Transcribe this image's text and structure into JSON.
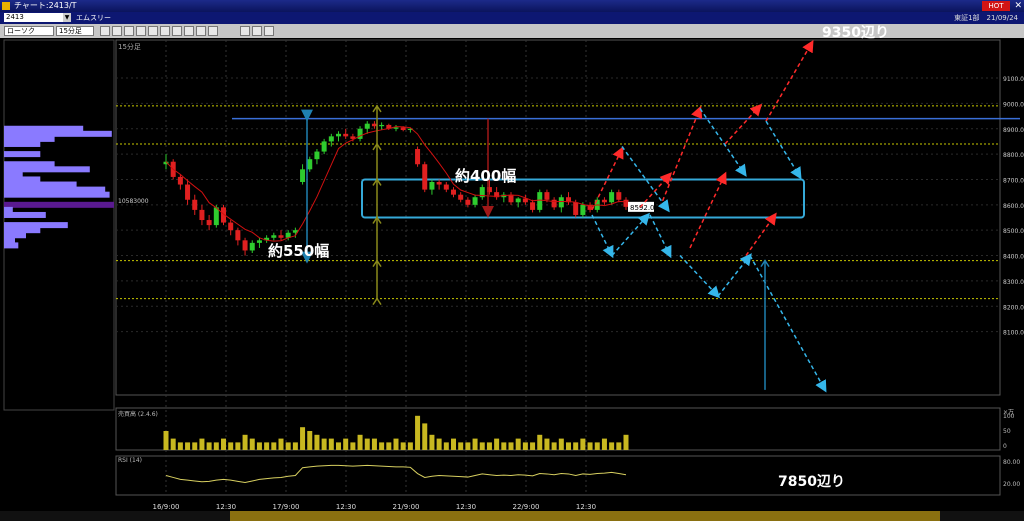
{
  "window": {
    "title": "チャート:2413/T",
    "hot_label": "HOT",
    "close_glyph": "✕",
    "symbol_code": "2413",
    "company": "エムスリー",
    "exchange_date": "東証1部　21/09/24"
  },
  "toolbar": {
    "chart_type": "ローソク",
    "timeframe": "15分足",
    "buttons": [
      "zoom-in-icon",
      "zoom-out-icon",
      "grid-icon",
      "bar-chart-icon",
      "line-chart-icon",
      "candle-icon",
      "draw-line-icon",
      "fib-icon",
      "marker-icon",
      "settings-icon",
      "circle-icon",
      "wave-icon",
      "text-icon"
    ]
  },
  "colors": {
    "up": "#2ecc2e",
    "down": "#e02020",
    "ma": "#d01010",
    "yellow_line": "#c8c800",
    "blue_line": "#3a6fd8",
    "cyan_box": "#35a9d8",
    "volume": "#c8b820",
    "arrow_red": "#ff2a2a",
    "arrow_cyan": "#35b6ea",
    "profile": "#8a7aff",
    "profile_highlight": "#5a1a90",
    "olive": "#8a8a1a",
    "steel": "#1f80b0",
    "maroon": "#a01818",
    "rsi": "#d8d060"
  },
  "chart_data": {
    "type": "candlestick",
    "timeframe_label": "15分足",
    "ylim": [
      7850,
      9250
    ],
    "y_ticks": [
      8100,
      8200,
      8300,
      8400,
      8500,
      8600,
      8700,
      8800,
      8900,
      9000,
      9100
    ],
    "x_labels": [
      "16/9:00",
      "12:30",
      "17/9:00",
      "12:30",
      "21/9:00",
      "12:30",
      "22/9:00",
      "12:30"
    ],
    "x_label_positions": [
      0,
      10,
      20,
      30,
      40,
      50,
      60,
      70
    ],
    "last_price": "8592.0",
    "mouse_price": "10583000",
    "levels": [
      8990,
      8840,
      8380,
      8230
    ],
    "resistance_line": 8940,
    "candles": [
      [
        8760,
        8800,
        8740,
        8770
      ],
      [
        8770,
        8780,
        8700,
        8710
      ],
      [
        8710,
        8720,
        8660,
        8680
      ],
      [
        8680,
        8700,
        8600,
        8620
      ],
      [
        8620,
        8640,
        8560,
        8580
      ],
      [
        8580,
        8600,
        8520,
        8540
      ],
      [
        8540,
        8560,
        8500,
        8520
      ],
      [
        8520,
        8600,
        8510,
        8590
      ],
      [
        8590,
        8600,
        8520,
        8530
      ],
      [
        8530,
        8540,
        8480,
        8500
      ],
      [
        8500,
        8510,
        8440,
        8460
      ],
      [
        8460,
        8470,
        8400,
        8420
      ],
      [
        8420,
        8460,
        8410,
        8450
      ],
      [
        8450,
        8470,
        8430,
        8460
      ],
      [
        8460,
        8480,
        8450,
        8470
      ],
      [
        8470,
        8490,
        8460,
        8480
      ],
      [
        8480,
        8500,
        8460,
        8470
      ],
      [
        8470,
        8500,
        8460,
        8490
      ],
      [
        8490,
        8510,
        8470,
        8500
      ],
      [
        8690,
        8760,
        8680,
        8740
      ],
      [
        8740,
        8790,
        8730,
        8780
      ],
      [
        8780,
        8820,
        8760,
        8810
      ],
      [
        8810,
        8860,
        8800,
        8850
      ],
      [
        8850,
        8880,
        8830,
        8870
      ],
      [
        8870,
        8890,
        8850,
        8880
      ],
      [
        8880,
        8900,
        8860,
        8870
      ],
      [
        8870,
        8880,
        8850,
        8860
      ],
      [
        8860,
        8910,
        8850,
        8900
      ],
      [
        8900,
        8930,
        8880,
        8920
      ],
      [
        8920,
        8930,
        8900,
        8910
      ],
      [
        8910,
        8925,
        8895,
        8915
      ],
      [
        8915,
        8920,
        8895,
        8900
      ],
      [
        8900,
        8915,
        8890,
        8905
      ],
      [
        8905,
        8910,
        8890,
        8895
      ],
      [
        8895,
        8905,
        8885,
        8900
      ],
      [
        8820,
        8830,
        8750,
        8760
      ],
      [
        8760,
        8770,
        8650,
        8660
      ],
      [
        8660,
        8700,
        8640,
        8690
      ],
      [
        8690,
        8700,
        8660,
        8680
      ],
      [
        8680,
        8690,
        8650,
        8660
      ],
      [
        8660,
        8670,
        8630,
        8640
      ],
      [
        8640,
        8650,
        8610,
        8620
      ],
      [
        8620,
        8630,
        8590,
        8600
      ],
      [
        8600,
        8640,
        8590,
        8630
      ],
      [
        8630,
        8680,
        8620,
        8670
      ],
      [
        8670,
        8700,
        8640,
        8650
      ],
      [
        8650,
        8670,
        8620,
        8630
      ],
      [
        8630,
        8650,
        8610,
        8640
      ],
      [
        8640,
        8650,
        8600,
        8610
      ],
      [
        8610,
        8630,
        8590,
        8625
      ],
      [
        8625,
        8640,
        8600,
        8610
      ],
      [
        8610,
        8620,
        8570,
        8580
      ],
      [
        8580,
        8660,
        8570,
        8650
      ],
      [
        8650,
        8660,
        8610,
        8620
      ],
      [
        8620,
        8630,
        8580,
        8590
      ],
      [
        8590,
        8640,
        8570,
        8630
      ],
      [
        8630,
        8650,
        8600,
        8610
      ],
      [
        8610,
        8620,
        8550,
        8560
      ],
      [
        8560,
        8610,
        8550,
        8600
      ],
      [
        8600,
        8610,
        8570,
        8580
      ],
      [
        8580,
        8630,
        8570,
        8620
      ],
      [
        8620,
        8630,
        8600,
        8610
      ],
      [
        8610,
        8660,
        8600,
        8650
      ],
      [
        8650,
        8660,
        8610,
        8620
      ],
      [
        8620,
        8630,
        8580,
        8592
      ]
    ],
    "volume_values": [
      5,
      3,
      2,
      2,
      2,
      3,
      2,
      2,
      3,
      2,
      2,
      4,
      3,
      2,
      2,
      2,
      3,
      2,
      2,
      6,
      5,
      4,
      3,
      3,
      2,
      3,
      2,
      4,
      3,
      3,
      2,
      2,
      3,
      2,
      2,
      9,
      7,
      4,
      3,
      2,
      3,
      2,
      2,
      3,
      2,
      2,
      3,
      2,
      2,
      3,
      2,
      2,
      4,
      3,
      2,
      3,
      2,
      2,
      3,
      2,
      2,
      3,
      2,
      2,
      4
    ],
    "rsi_values": [
      50,
      45,
      40,
      38,
      36,
      34,
      35,
      38,
      40,
      38,
      35,
      32,
      36,
      40,
      42,
      44,
      45,
      48,
      50,
      70,
      72,
      74,
      75,
      76,
      76,
      75,
      74,
      75,
      76,
      75,
      74,
      73,
      72,
      72,
      71,
      55,
      45,
      48,
      50,
      49,
      48,
      47,
      46,
      50,
      54,
      52,
      50,
      51,
      50,
      52,
      51,
      49,
      55,
      54,
      52,
      55,
      54,
      50,
      54,
      53,
      55,
      56,
      58,
      55,
      52
    ],
    "profile_bars": [
      {
        "price": 8900,
        "width": 0.72
      },
      {
        "price": 8880,
        "width": 0.98
      },
      {
        "price": 8860,
        "width": 0.46
      },
      {
        "price": 8840,
        "width": 0.33
      },
      {
        "price": 8800,
        "width": 0.33
      },
      {
        "price": 8760,
        "width": 0.46
      },
      {
        "price": 8740,
        "width": 0.78
      },
      {
        "price": 8720,
        "width": 0.17
      },
      {
        "price": 8700,
        "width": 0.33
      },
      {
        "price": 8680,
        "width": 0.66
      },
      {
        "price": 8660,
        "width": 0.92
      },
      {
        "price": 8640,
        "width": 0.96
      },
      {
        "price": 8600,
        "width": 1.0,
        "highlight": true
      },
      {
        "price": 8580,
        "width": 0.08
      },
      {
        "price": 8560,
        "width": 0.38
      },
      {
        "price": 8520,
        "width": 0.58
      },
      {
        "price": 8500,
        "width": 0.33
      },
      {
        "price": 8480,
        "width": 0.2
      },
      {
        "price": 8460,
        "width": 0.1
      },
      {
        "price": 8440,
        "width": 0.13
      }
    ],
    "annotations": {
      "w550": "約550幅",
      "w400": "約400幅",
      "target_high": "9350辺り",
      "target_low": "7850辺り"
    },
    "volume_panel": {
      "label": "売買高 (2.4.6)",
      "unit_label": "×万",
      "ticks": [
        100,
        50,
        0
      ]
    },
    "rsi_panel": {
      "label": "RSI (14)",
      "ticks": [
        "80.00",
        "20.00"
      ]
    }
  }
}
